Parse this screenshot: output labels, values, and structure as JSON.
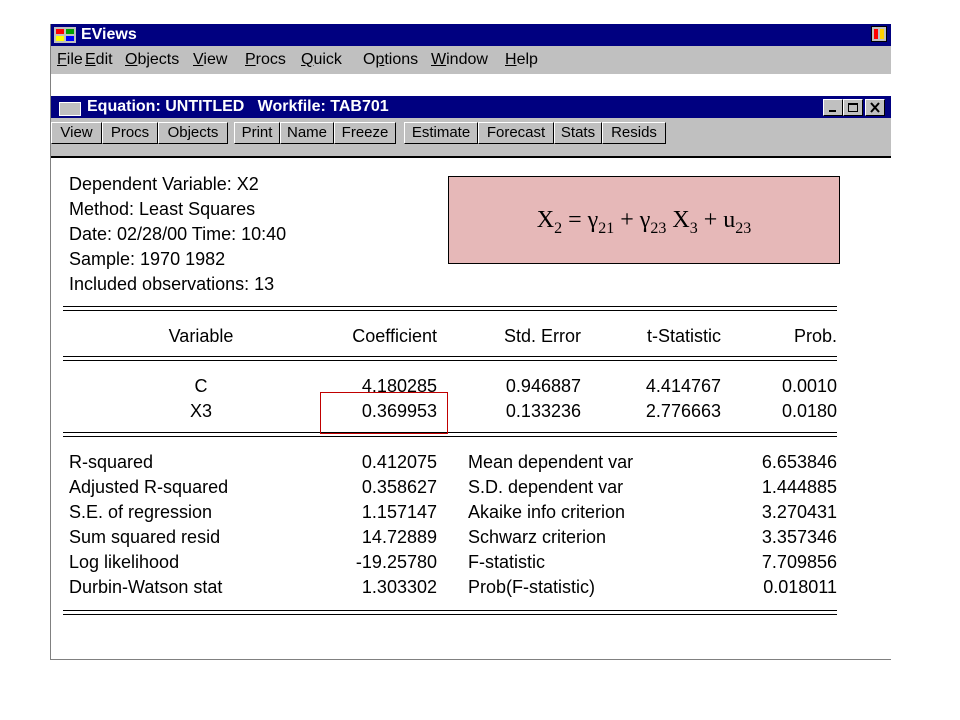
{
  "app": {
    "title": "EViews",
    "menu": [
      {
        "u": "F",
        "rest": "ile"
      },
      {
        "u": "E",
        "rest": "dit"
      },
      {
        "u": "O",
        "rest": "bjects"
      },
      {
        "u": "V",
        "rest": "iew"
      },
      {
        "u": "P",
        "rest": "rocs"
      },
      {
        "u": "Q",
        "rest": "uick"
      },
      {
        "pre": "O",
        "u": "p",
        "rest": "tions"
      },
      {
        "u": "W",
        "rest": "indow"
      },
      {
        "u": "H",
        "rest": "elp"
      }
    ]
  },
  "equation_window": {
    "title": "Equation: UNTITLED   Workfile: TAB701",
    "toolbar": [
      "View",
      "Procs",
      "Objects",
      "Print",
      "Name",
      "Freeze",
      "Estimate",
      "Forecast",
      "Stats",
      "Resids"
    ]
  },
  "header": {
    "dependent": "Dependent Variable: X2",
    "method": "Method: Least Squares",
    "date": "Date: 02/28/00   Time: 10:40",
    "sample": "Sample: 1970 1982",
    "included": "Included observations: 13"
  },
  "table": {
    "columns": [
      "Variable",
      "Coefficient",
      "Std. Error",
      "t-Statistic",
      "Prob."
    ],
    "rows": [
      {
        "variable": "C",
        "coef": "4.180285",
        "se": "0.946887",
        "t": "4.414767",
        "prob": "0.0010"
      },
      {
        "variable": "X3",
        "coef": "0.369953",
        "se": "0.133236",
        "t": "2.776663",
        "prob": "0.0180"
      }
    ]
  },
  "stats": {
    "left": [
      {
        "label": "R-squared",
        "value": "0.412075"
      },
      {
        "label": "Adjusted R-squared",
        "value": "0.358627"
      },
      {
        "label": "S.E. of regression",
        "value": "1.157147"
      },
      {
        "label": "Sum squared resid",
        "value": "14.72889"
      },
      {
        "label": "Log likelihood",
        "value": "-19.25780"
      },
      {
        "label": "Durbin-Watson stat",
        "value": "1.303302"
      }
    ],
    "right": [
      {
        "label": "Mean dependent var",
        "value": "6.653846"
      },
      {
        "label": "S.D. dependent var",
        "value": "1.444885"
      },
      {
        "label": "Akaike info criterion",
        "value": "3.270431"
      },
      {
        "label": "Schwarz criterion",
        "value": "3.357346"
      },
      {
        "label": "F-statistic",
        "value": "7.709856"
      },
      {
        "label": "Prob(F-statistic)",
        "value": "0.018011"
      }
    ]
  },
  "formula": {
    "x": "X",
    "x_sub": "2",
    "eq": " = ",
    "g1": "γ",
    "g1_sub": "21",
    "plus1": " + ",
    "g2": "γ",
    "g2_sub": "23",
    "x3": " X",
    "x3_sub": "3",
    "plus2": " + ",
    "u": "u",
    "u_sub": "23"
  },
  "colors": {
    "titlebar": "#000080",
    "chrome": "#c0c0c0",
    "formula_bg": "#e6b8b8",
    "highlight": "#c00000"
  }
}
